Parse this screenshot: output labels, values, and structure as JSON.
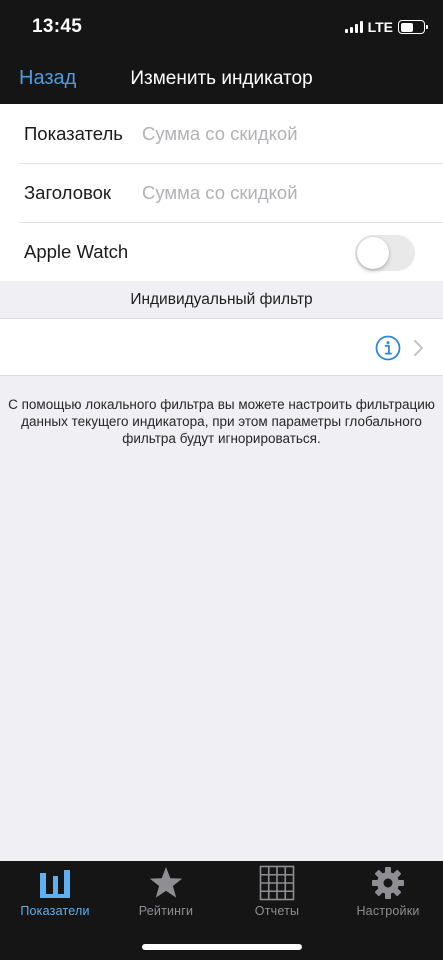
{
  "status_bar": {
    "time": "13:45",
    "network": "LTE"
  },
  "nav": {
    "back_label": "Назад",
    "title": "Изменить индикатор"
  },
  "form": {
    "indicator": {
      "label": "Показатель",
      "placeholder": "Сумма со скидкой"
    },
    "title": {
      "label": "Заголовок",
      "placeholder": "Сумма со скидкой"
    },
    "apple_watch": {
      "label": "Apple Watch",
      "enabled": false
    }
  },
  "filter_section": {
    "header": "Индивидуальный фильтр",
    "help_text": "С помощью локального фильтра вы можете настроить фильтрацию данных текущего индикатора, при этом параметры глобального фильтра будут игнорироваться."
  },
  "tabbar": {
    "tabs": [
      {
        "label": "Показатели",
        "icon": "indicators-icon",
        "active": true
      },
      {
        "label": "Рейтинги",
        "icon": "star-icon",
        "active": false
      },
      {
        "label": "Отчеты",
        "icon": "grid-icon",
        "active": false
      },
      {
        "label": "Настройки",
        "icon": "gear-icon",
        "active": false
      }
    ]
  },
  "colors": {
    "accent": "#4d9de0",
    "bar_background": "#151515",
    "page_background": "#efeff4",
    "tab_inactive": "#8e8e93"
  }
}
